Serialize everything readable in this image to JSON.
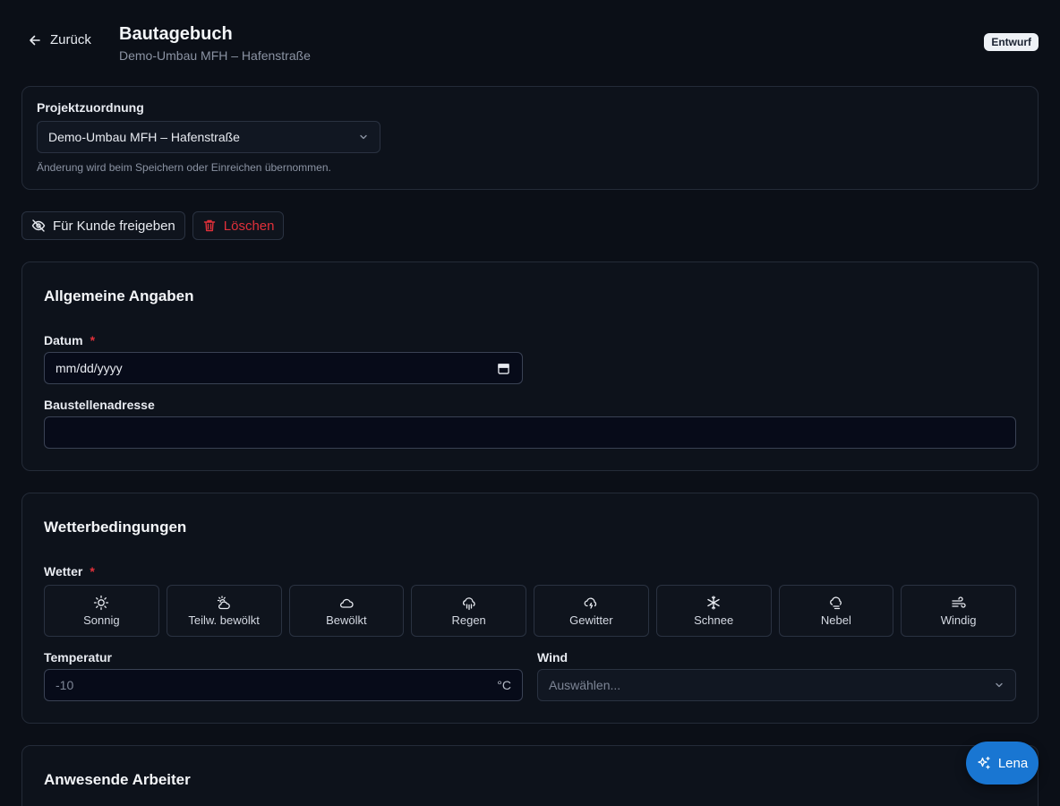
{
  "header": {
    "back_label": "Zurück",
    "title": "Bautagebuch",
    "subtitle": "Demo-Umbau MFH – Hafenstraße",
    "status": "Entwurf"
  },
  "project": {
    "label": "Projektzuordnung",
    "selected": "Demo-Umbau MFH – Hafenstraße",
    "hint": "Änderung wird beim Speichern oder Einreichen übernommen."
  },
  "actions": {
    "release": "Für Kunde freigeben",
    "delete": "Löschen"
  },
  "general": {
    "title": "Allgemeine Angaben",
    "date_label": "Datum",
    "required_mark": "*",
    "date_placeholder": "mm/dd/yyyy",
    "address_label": "Baustellenadresse",
    "address_value": ""
  },
  "weather": {
    "title": "Wetterbedingungen",
    "weather_label": "Wetter",
    "required_mark": "*",
    "options": [
      {
        "label": "Sonnig",
        "icon": "sun-icon"
      },
      {
        "label": "Teilw. bewölkt",
        "icon": "cloud-sun-icon"
      },
      {
        "label": "Bewölkt",
        "icon": "cloud-icon"
      },
      {
        "label": "Regen",
        "icon": "cloud-rain-icon"
      },
      {
        "label": "Gewitter",
        "icon": "cloud-lightning-icon"
      },
      {
        "label": "Schnee",
        "icon": "snowflake-icon"
      },
      {
        "label": "Nebel",
        "icon": "cloud-fog-icon"
      },
      {
        "label": "Windig",
        "icon": "wind-icon"
      }
    ],
    "temperature_label": "Temperatur",
    "temperature_placeholder": "-10",
    "temperature_unit": "°C",
    "wind_label": "Wind",
    "wind_placeholder": "Auswählen..."
  },
  "workers": {
    "title": "Anwesende Arbeiter"
  },
  "assistant": {
    "label": "Lena"
  },
  "colors": {
    "background": "#0b0f17",
    "accent": "#1976d2",
    "danger": "#e0303a"
  }
}
